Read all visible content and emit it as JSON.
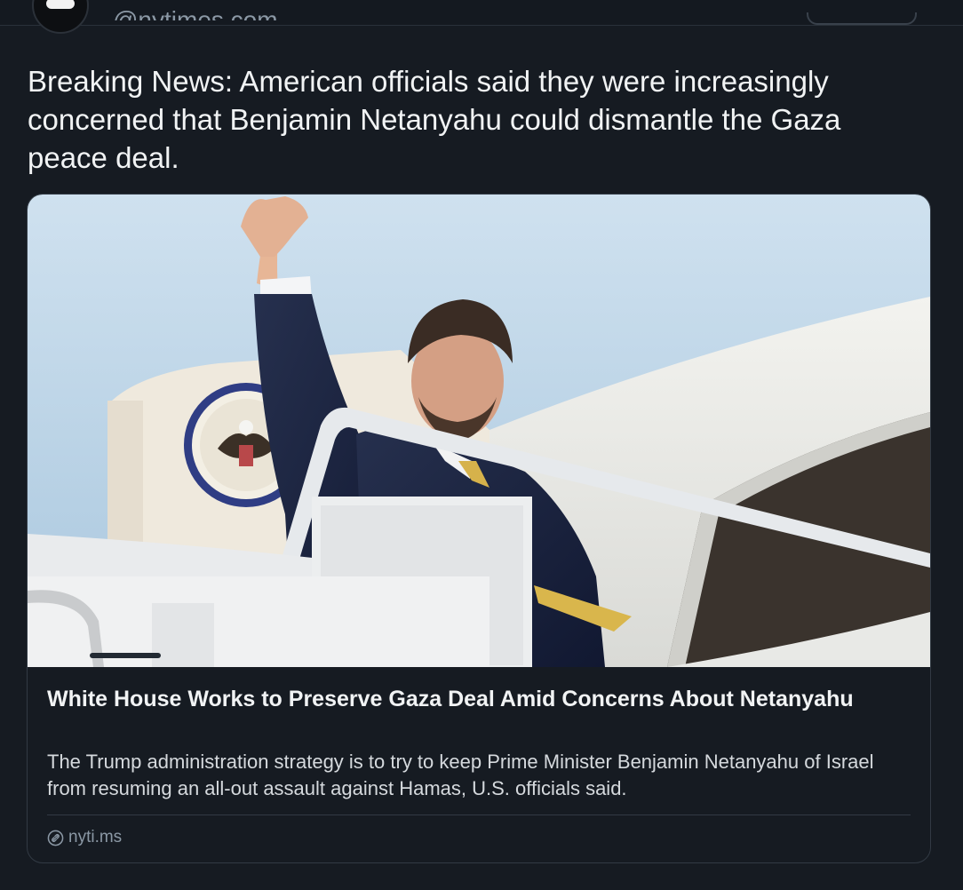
{
  "post": {
    "author_handle": "@nytimes.com",
    "text": "Breaking News: American officials said they were increasingly concerned that Benjamin Netanyahu could dismantle the Gaza peace deal."
  },
  "link_card": {
    "image_icon": "photo-vice-president-waving-from-aircraft-stairs",
    "title": "White House Works to Preserve Gaza Deal Amid Concerns About Netanyahu",
    "description": "The Trump administration strategy is to try to keep Prime Minister Benjamin Netanyahu of Israel from resuming an all-out assault against Hamas, U.S. officials said.",
    "domain": "nyti.ms",
    "domain_icon": "link-icon"
  },
  "colors": {
    "background": "#161b22",
    "text_primary": "#f1f3f4",
    "text_secondary": "#8b98a5",
    "border": "#323a44"
  }
}
